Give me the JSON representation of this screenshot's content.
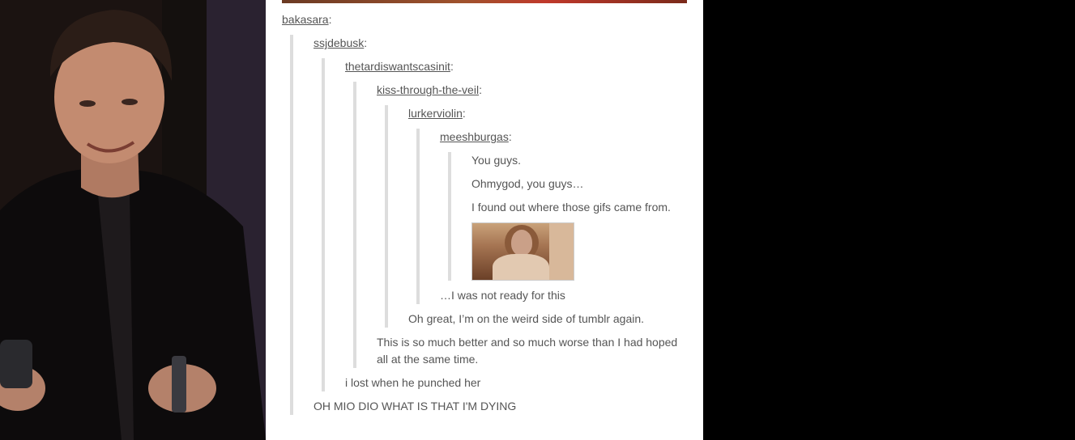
{
  "thread": {
    "users": {
      "u1": "bakasara",
      "u2": "ssjdebusk",
      "u3": "thetardiswantscasinit",
      "u4": "kiss-through-the-veil",
      "u5": "lurkerviolin",
      "u6": "meeshburgas"
    },
    "colon": ":",
    "origin": {
      "line1": "You guys.",
      "line2": "Ohmygod, you guys…",
      "line3": "I found out where those gifs came from."
    },
    "replies": {
      "r5": "…I was not ready for this",
      "r4": "Oh great, I’m on the weird side of tumblr again.",
      "r3": "This is so much better and so much worse than I had hoped all at the same time.",
      "r2": "i lost when he punched her",
      "r1": "OH MIO DIO WHAT IS THAT I'M DYING"
    }
  },
  "colors": {
    "link": "#555555",
    "text": "#555555",
    "quote_border": "#dddddd",
    "background": "#000000"
  }
}
